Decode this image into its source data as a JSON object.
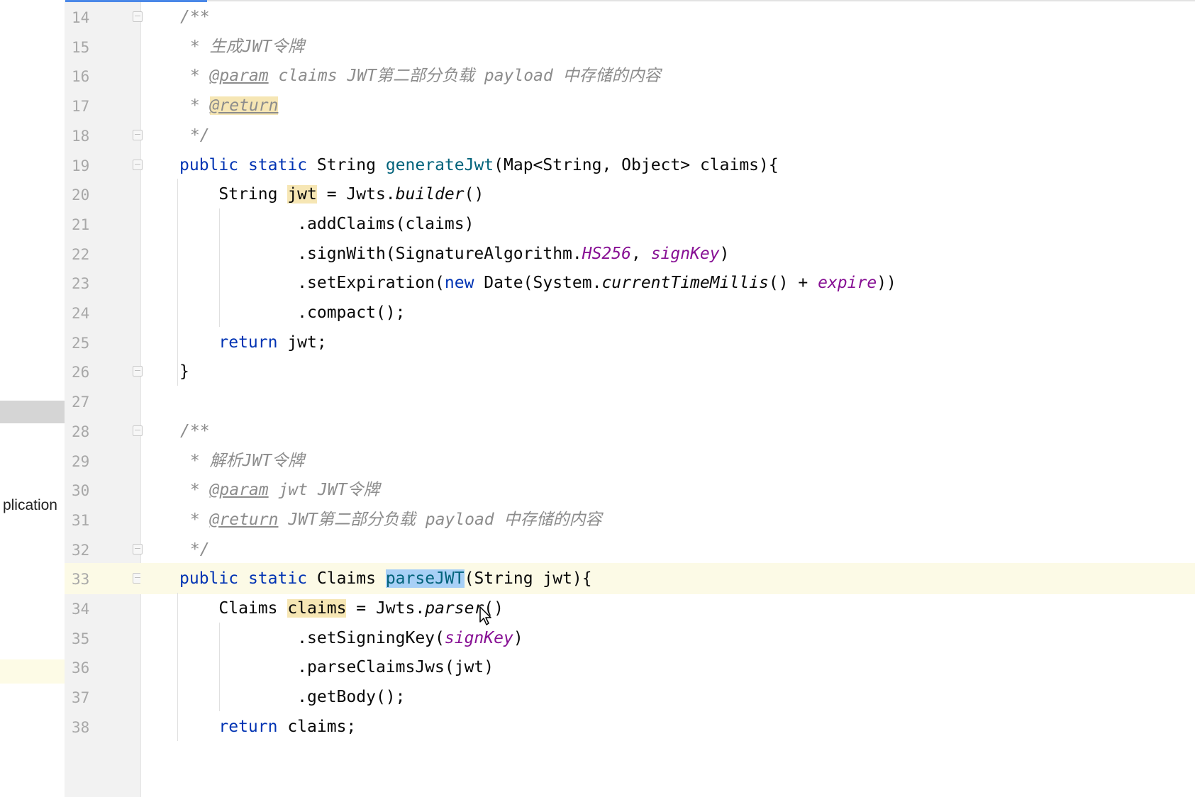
{
  "project_panel": {
    "visible_label": "plication"
  },
  "editor": {
    "lines": [
      {
        "no": "14",
        "tokens": [
          {
            "t": "/**",
            "c": "cmt"
          }
        ]
      },
      {
        "no": "15",
        "tokens": [
          {
            "t": " * ",
            "c": "cmt"
          },
          {
            "t": "生成JWT令牌",
            "c": "cmt"
          }
        ]
      },
      {
        "no": "16",
        "tokens": [
          {
            "t": " * ",
            "c": "cmt"
          },
          {
            "t": "@param",
            "c": "tag"
          },
          {
            "t": " claims ",
            "c": "cmt"
          },
          {
            "t": "JWT第二部分负载 payload 中存储的内容",
            "c": "cmt"
          }
        ]
      },
      {
        "no": "17",
        "tokens": [
          {
            "t": " * ",
            "c": "cmt"
          },
          {
            "t": "@return",
            "c": "tag tag-hl"
          }
        ]
      },
      {
        "no": "18",
        "tokens": [
          {
            "t": " */",
            "c": "cmt"
          }
        ]
      },
      {
        "no": "19",
        "tokens": [
          {
            "t": "public",
            "c": "kw"
          },
          {
            "t": " "
          },
          {
            "t": "static",
            "c": "kw"
          },
          {
            "t": " String "
          },
          {
            "t": "generateJwt",
            "c": "fn"
          },
          {
            "t": "(Map<String, Object> claims){"
          }
        ]
      },
      {
        "no": "20",
        "tokens": [
          {
            "t": "    String "
          },
          {
            "t": "jwt",
            "c": "var-hl"
          },
          {
            "t": " = Jwts."
          },
          {
            "t": "builder",
            "c": "it"
          },
          {
            "t": "()"
          }
        ]
      },
      {
        "no": "21",
        "tokens": [
          {
            "t": "            .addClaims(claims)"
          }
        ]
      },
      {
        "no": "22",
        "tokens": [
          {
            "t": "            .signWith(SignatureAlgorithm."
          },
          {
            "t": "HS256",
            "c": "field"
          },
          {
            "t": ", "
          },
          {
            "t": "signKey",
            "c": "field"
          },
          {
            "t": ")"
          }
        ]
      },
      {
        "no": "23",
        "tokens": [
          {
            "t": "            .setExpiration("
          },
          {
            "t": "new",
            "c": "kw"
          },
          {
            "t": " Date(System."
          },
          {
            "t": "currentTimeMillis",
            "c": "it"
          },
          {
            "t": "() + "
          },
          {
            "t": "expire",
            "c": "field"
          },
          {
            "t": "))"
          }
        ]
      },
      {
        "no": "24",
        "tokens": [
          {
            "t": "            .compact();"
          }
        ]
      },
      {
        "no": "25",
        "tokens": [
          {
            "t": "    "
          },
          {
            "t": "return",
            "c": "kw"
          },
          {
            "t": " jwt;"
          }
        ]
      },
      {
        "no": "26",
        "tokens": [
          {
            "t": "}"
          }
        ]
      },
      {
        "no": "27",
        "tokens": []
      },
      {
        "no": "28",
        "tokens": [
          {
            "t": "/**",
            "c": "cmt"
          }
        ]
      },
      {
        "no": "29",
        "tokens": [
          {
            "t": " * ",
            "c": "cmt"
          },
          {
            "t": "解析JWT令牌",
            "c": "cmt"
          }
        ]
      },
      {
        "no": "30",
        "tokens": [
          {
            "t": " * ",
            "c": "cmt"
          },
          {
            "t": "@param",
            "c": "tag"
          },
          {
            "t": " jwt ",
            "c": "cmt"
          },
          {
            "t": "JWT令牌",
            "c": "cmt"
          }
        ]
      },
      {
        "no": "31",
        "tokens": [
          {
            "t": " * ",
            "c": "cmt"
          },
          {
            "t": "@return",
            "c": "tag"
          },
          {
            "t": " JWT第二部分负载 payload 中存储的内容",
            "c": "cmt"
          }
        ]
      },
      {
        "no": "32",
        "tokens": [
          {
            "t": " */",
            "c": "cmt"
          }
        ]
      },
      {
        "no": "33",
        "tokens": [
          {
            "t": "public",
            "c": "kw"
          },
          {
            "t": " "
          },
          {
            "t": "static",
            "c": "kw"
          },
          {
            "t": " Claims "
          },
          {
            "t": "parseJWT",
            "c": "fn sel"
          },
          {
            "t": "(String jwt){"
          }
        ]
      },
      {
        "no": "34",
        "tokens": [
          {
            "t": "    Claims "
          },
          {
            "t": "claims",
            "c": "var-hl"
          },
          {
            "t": " = Jwts."
          },
          {
            "t": "parser",
            "c": "it"
          },
          {
            "t": "()"
          }
        ]
      },
      {
        "no": "35",
        "tokens": [
          {
            "t": "            .setSigningKey("
          },
          {
            "t": "signKey",
            "c": "field"
          },
          {
            "t": ")"
          }
        ]
      },
      {
        "no": "36",
        "tokens": [
          {
            "t": "            .parseClaimsJws(jwt)"
          }
        ]
      },
      {
        "no": "37",
        "tokens": [
          {
            "t": "            .getBody();"
          }
        ]
      },
      {
        "no": "38",
        "tokens": [
          {
            "t": "    "
          },
          {
            "t": "return",
            "c": "kw"
          },
          {
            "t": " claims;"
          }
        ]
      }
    ]
  },
  "colors": {
    "keyword": "#0033b3",
    "method": "#00627a",
    "field": "#871094",
    "comment": "#8c8c8c",
    "selection": "#a8d0f6",
    "identifier_highlight": "#f6e6b4",
    "caret_line": "#fcfae6"
  }
}
